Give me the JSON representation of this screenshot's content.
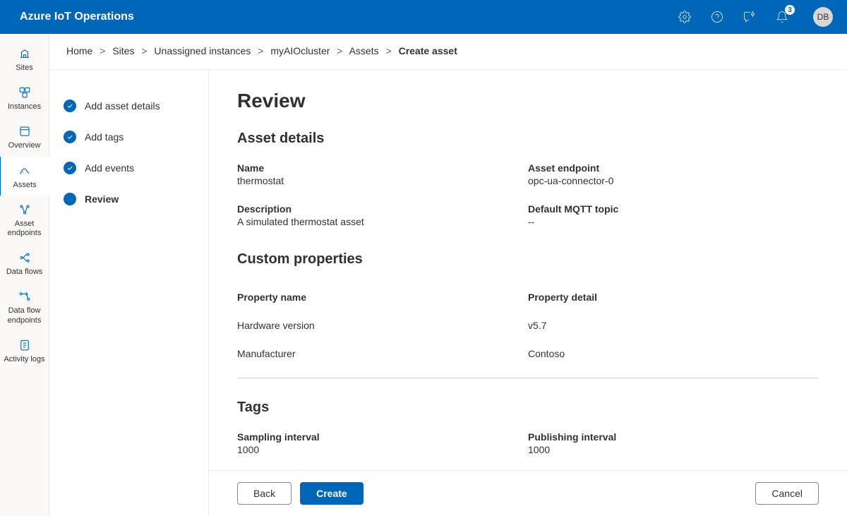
{
  "appTitle": "Azure IoT Operations",
  "notificationCount": "3",
  "userInitials": "DB",
  "leftnav": [
    {
      "label": "Sites"
    },
    {
      "label": "Instances"
    },
    {
      "label": "Overview"
    },
    {
      "label": "Assets"
    },
    {
      "label": "Asset endpoints"
    },
    {
      "label": "Data flows"
    },
    {
      "label": "Data flow endpoints"
    },
    {
      "label": "Activity logs"
    }
  ],
  "breadcrumb": {
    "items": [
      "Home",
      "Sites",
      "Unassigned instances",
      "myAIOcluster",
      "Assets"
    ],
    "current": "Create asset"
  },
  "steps": [
    {
      "label": "Add asset details"
    },
    {
      "label": "Add tags"
    },
    {
      "label": "Add events"
    },
    {
      "label": "Review"
    }
  ],
  "review": {
    "title": "Review",
    "sections": {
      "assetDetails": {
        "heading": "Asset details",
        "name": {
          "label": "Name",
          "value": "thermostat"
        },
        "endpoint": {
          "label": "Asset endpoint",
          "value": "opc-ua-connector-0"
        },
        "description": {
          "label": "Description",
          "value": "A simulated thermostat asset"
        },
        "mqtt": {
          "label": "Default MQTT topic",
          "value": "--"
        }
      },
      "customProps": {
        "heading": "Custom properties",
        "header": {
          "name": "Property name",
          "detail": "Property detail"
        },
        "rows": [
          {
            "name": "Hardware version",
            "detail": "v5.7"
          },
          {
            "name": "Manufacturer",
            "detail": "Contoso"
          }
        ]
      },
      "tags": {
        "heading": "Tags",
        "sampling": {
          "label": "Sampling interval",
          "value": "1000"
        },
        "publishing": {
          "label": "Publishing interval",
          "value": "1000"
        }
      }
    }
  },
  "buttons": {
    "back": "Back",
    "create": "Create",
    "cancel": "Cancel"
  }
}
